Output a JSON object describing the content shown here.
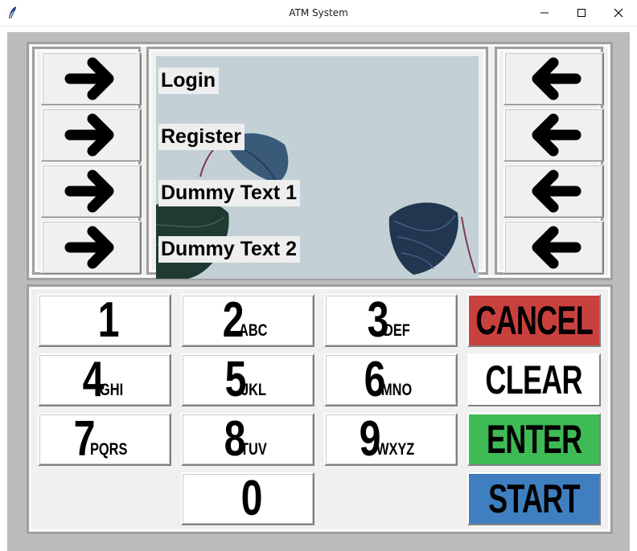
{
  "window": {
    "title": "ATM System"
  },
  "screen": {
    "menu": [
      {
        "label": "Login"
      },
      {
        "label": "Register"
      },
      {
        "label": "Dummy Text 1"
      },
      {
        "label": "Dummy Text 2"
      }
    ]
  },
  "keypad": {
    "keys": [
      {
        "digit": "1",
        "letters": ""
      },
      {
        "digit": "2",
        "letters": "ABC"
      },
      {
        "digit": "3",
        "letters": "DEF"
      },
      {
        "digit": "4",
        "letters": "GHI"
      },
      {
        "digit": "5",
        "letters": "JKL"
      },
      {
        "digit": "6",
        "letters": "MNO"
      },
      {
        "digit": "7",
        "letters": "PQRS"
      },
      {
        "digit": "8",
        "letters": "TUV"
      },
      {
        "digit": "9",
        "letters": "WXYZ"
      },
      {
        "digit": "0",
        "letters": ""
      }
    ],
    "functions": {
      "cancel": {
        "label": "CANCEL",
        "color": "#c9413f"
      },
      "clear": {
        "label": "CLEAR",
        "color": "#ffffff"
      },
      "enter": {
        "label": "ENTER",
        "color": "#3ebb55"
      },
      "start": {
        "label": "START",
        "color": "#3f7fbf"
      }
    }
  },
  "icons": {
    "side_left": "arrow-right-icon",
    "side_right": "arrow-left-icon"
  }
}
